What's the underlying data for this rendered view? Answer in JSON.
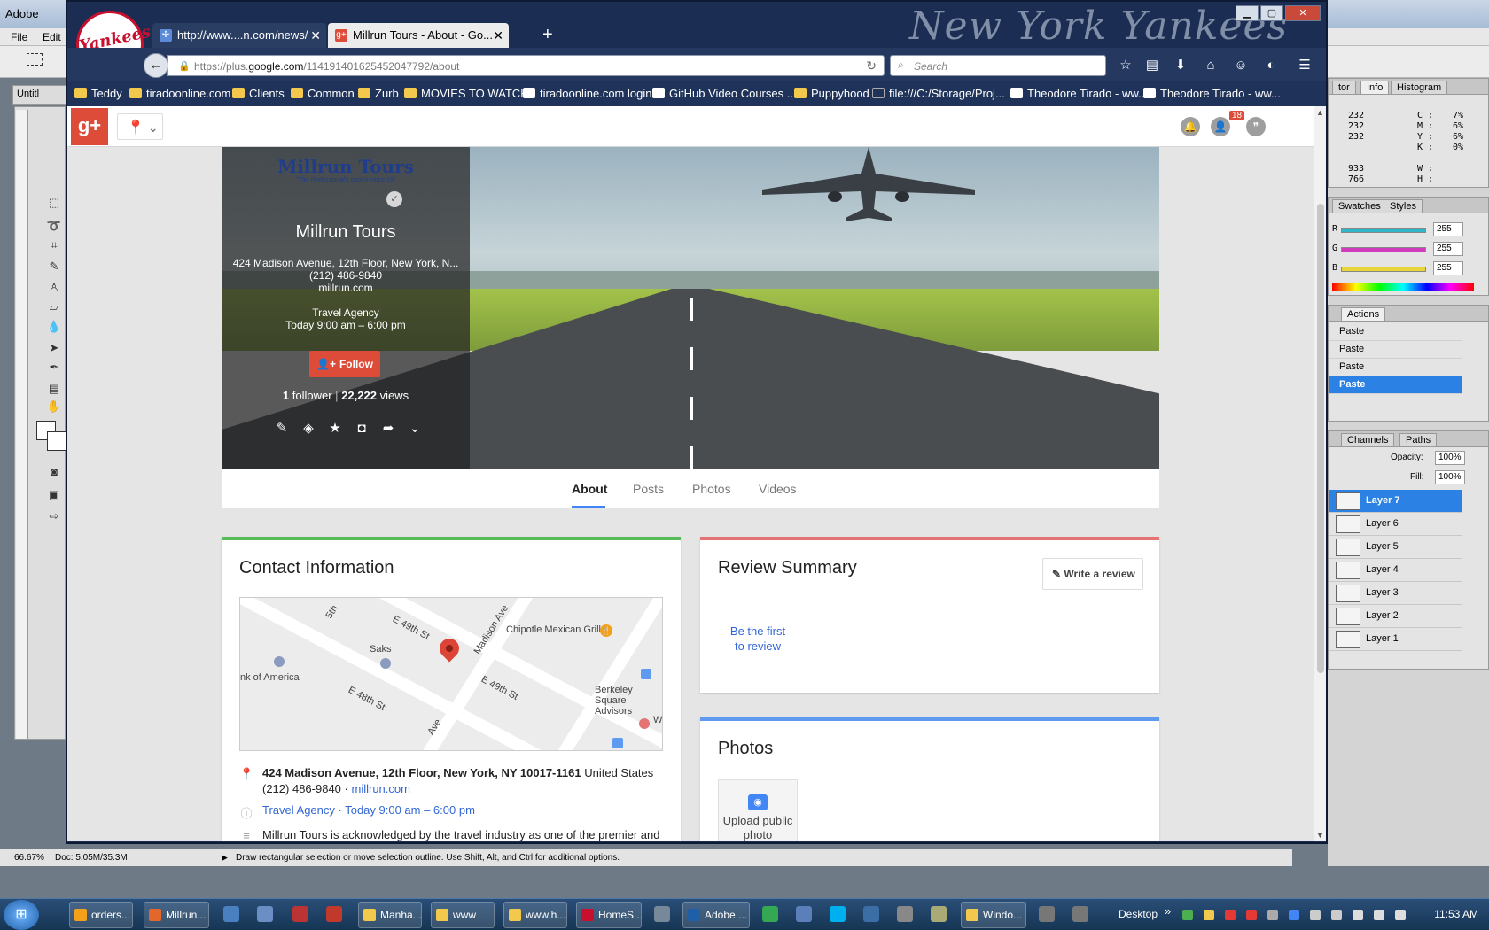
{
  "photoshop": {
    "title": "Adobe",
    "menu": [
      "File",
      "Edit"
    ],
    "doc_tab": "Untitl",
    "status_zoom": "66.67%",
    "status_doc": "Doc: 5.05M/35.3M",
    "status_hint": "Draw rectangular selection or move selection outline.  Use Shift, Alt, and Ctrl for additional options.",
    "info_panel": {
      "tabs": [
        "tor",
        "Info",
        "Histogram"
      ],
      "rgb": [
        "232",
        "232",
        "232"
      ],
      "cmyk": [
        {
          "label": "C :",
          "value": "7%"
        },
        {
          "label": "M :",
          "value": "6%"
        },
        {
          "label": "Y :",
          "value": "6%"
        },
        {
          "label": "K :",
          "value": "0%"
        }
      ],
      "xy": [
        "933",
        "766"
      ],
      "wh": [
        "W :",
        "H :"
      ]
    },
    "color_panel": {
      "tabs": [
        "Swatches",
        "Styles"
      ],
      "channels": [
        {
          "label": "R",
          "value": "255",
          "color": "#2fb7c7"
        },
        {
          "label": "G",
          "value": "255",
          "color": "#d13bbd"
        },
        {
          "label": "B",
          "value": "255",
          "color": "#e6d63a"
        }
      ]
    },
    "actions_panel": {
      "tab": "Actions",
      "items": [
        "Paste",
        "Paste",
        "Paste",
        "Paste"
      ],
      "selected_index": 3
    },
    "layers_panel": {
      "tabs": [
        "Channels",
        "Paths"
      ],
      "opacity_label": "Opacity:",
      "opacity": "100%",
      "fill_label": "Fill:",
      "fill": "100%",
      "layers": [
        "Layer 7",
        "Layer 6",
        "Layer 5",
        "Layer 4",
        "Layer 3",
        "Layer 2",
        "Layer 1"
      ],
      "selected_index": 0
    }
  },
  "browser": {
    "brand_watermark": "New York Yankees",
    "logo_text": "Yankees",
    "tabs": [
      {
        "title": "http://www....n.com/news/",
        "active": false
      },
      {
        "title": "Millrun Tours - About - Go...",
        "active": true
      }
    ],
    "url_prefix": "https://plus.",
    "url_domain": "google.com",
    "url_path": "/114191401625452047792/about",
    "search_placeholder": "Search",
    "bookmarks": [
      {
        "label": "Teddy",
        "icon": "folder"
      },
      {
        "label": "tiradoonline.com",
        "icon": "folder"
      },
      {
        "label": "Clients",
        "icon": "folder"
      },
      {
        "label": "Common",
        "icon": "folder"
      },
      {
        "label": "Zurb",
        "icon": "folder"
      },
      {
        "label": "MOVIES TO WATCH",
        "icon": "folder"
      },
      {
        "label": "tiradoonline.com login",
        "icon": "page"
      },
      {
        "label": "GitHub Video Courses ...",
        "icon": "page"
      },
      {
        "label": "Puppyhood",
        "icon": "folder"
      },
      {
        "label": "file:///C:/Storage/Proj...",
        "icon": "page"
      },
      {
        "label": "Theodore Tirado - ww...",
        "icon": "page"
      },
      {
        "label": "Theodore Tirado - ww...",
        "icon": "page"
      }
    ]
  },
  "gplus": {
    "logo": "g+",
    "notification_count": "18",
    "page": {
      "logo_name": "Millrun Tours",
      "logo_tagline": "\"The Professional's choice since 19\"",
      "name": "Millrun Tours",
      "address": "424 Madison Avenue, 12th Floor, New York, N...",
      "phone": "(212) 486-9840",
      "website": "millrun.com",
      "category": "Travel Agency",
      "hours": "Today 9:00 am – 6:00 pm",
      "follow_label": "Follow",
      "followers_count": "1",
      "followers_label": "follower",
      "separator": "|",
      "views_count": "22,222",
      "views_label": "views"
    },
    "tabs": [
      "About",
      "Posts",
      "Photos",
      "Videos"
    ],
    "active_tab": "About",
    "contact": {
      "title": "Contact Information",
      "address_bold": "424 Madison Avenue, 12th Floor, New York, NY 10017-1161",
      "country": "United States",
      "phone": "(212) 486-9840",
      "phone_sep": "·",
      "website": "millrun.com",
      "category_hours": "Travel Agency · Today 9:00 am – 6:00 pm",
      "description_partial": "Millrun Tours is acknowledged by the travel industry as one of the premier and",
      "map_labels": [
        "E 49th St",
        "Madison Ave",
        "Chipotle Mexican Grill",
        "Saks",
        "nk of America",
        "E 48th St",
        "E 49th St",
        "Berkeley",
        "Square",
        "Advisors",
        "Ave",
        "5th",
        "W"
      ]
    },
    "review": {
      "title": "Review Summary",
      "write_label": "Write a review",
      "first_line1": "Be the first",
      "first_line2": "to review"
    },
    "photos": {
      "title": "Photos",
      "upload_line1": "Upload public",
      "upload_line2": "photo"
    },
    "colors": {
      "contact_stripe": "#57bb5a",
      "review_stripe": "#e57373",
      "photos_stripe": "#5e9bf0",
      "brand_red": "#dd4b39",
      "link": "#3367d6"
    }
  },
  "taskbar": {
    "items": [
      {
        "label": "orders...",
        "color": "#f4a11a"
      },
      {
        "label": "Millrun...",
        "color": "#e2672a"
      },
      {
        "label": "Manha...",
        "color": "#f2c94c"
      },
      {
        "label": "www",
        "color": "#f2c94c"
      },
      {
        "label": "www.h...",
        "color": "#f2c94c"
      },
      {
        "label": "HomeS...",
        "color": "#c8102e"
      },
      {
        "label": "Adobe ...",
        "color": "#1f5fa8"
      },
      {
        "label": "Windo...",
        "color": "#f2c94c"
      }
    ],
    "desktop_label": "Desktop",
    "chevrons": "»",
    "clock": "11:53 AM"
  }
}
